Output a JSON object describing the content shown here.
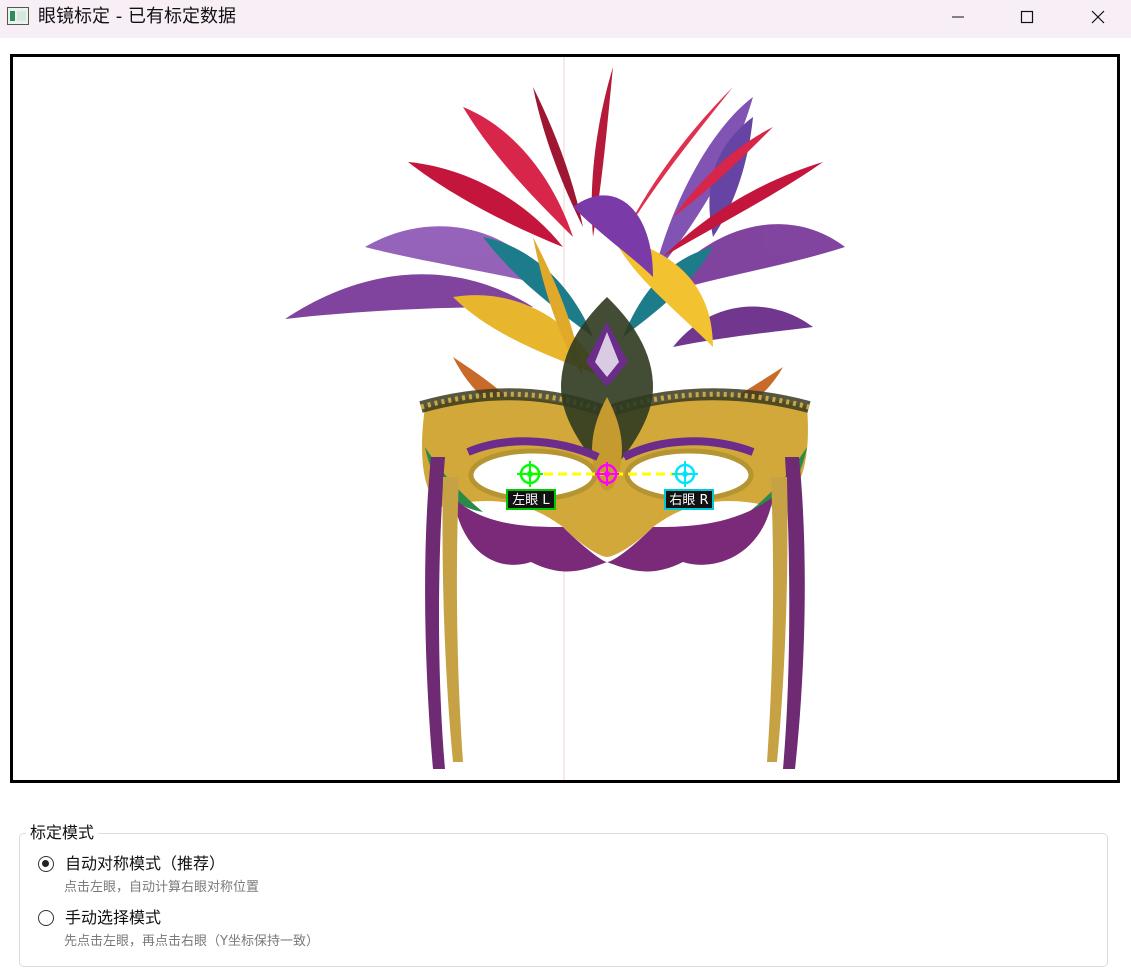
{
  "window": {
    "title": "眼镜标定 - 已有标定数据",
    "controls": [
      "minimize",
      "maximize",
      "close"
    ]
  },
  "canvas": {
    "image": "carnival mask with feathers",
    "markers": {
      "left_eye_label": "左眼 L",
      "right_eye_label": "右眼 R",
      "left_color": "#00ff00",
      "right_color": "#00e5ff",
      "center_color": "#ff00ff",
      "line_color": "#ffff00"
    }
  },
  "mode_group": {
    "title": "标定模式",
    "options": [
      {
        "label": "自动对称模式（推荐）",
        "description": "点击左眼，自动计算右眼对称位置",
        "checked": true
      },
      {
        "label": "手动选择模式",
        "description": "先点击左眼，再点击右眼（Y坐标保持一致）",
        "checked": false
      }
    ]
  }
}
